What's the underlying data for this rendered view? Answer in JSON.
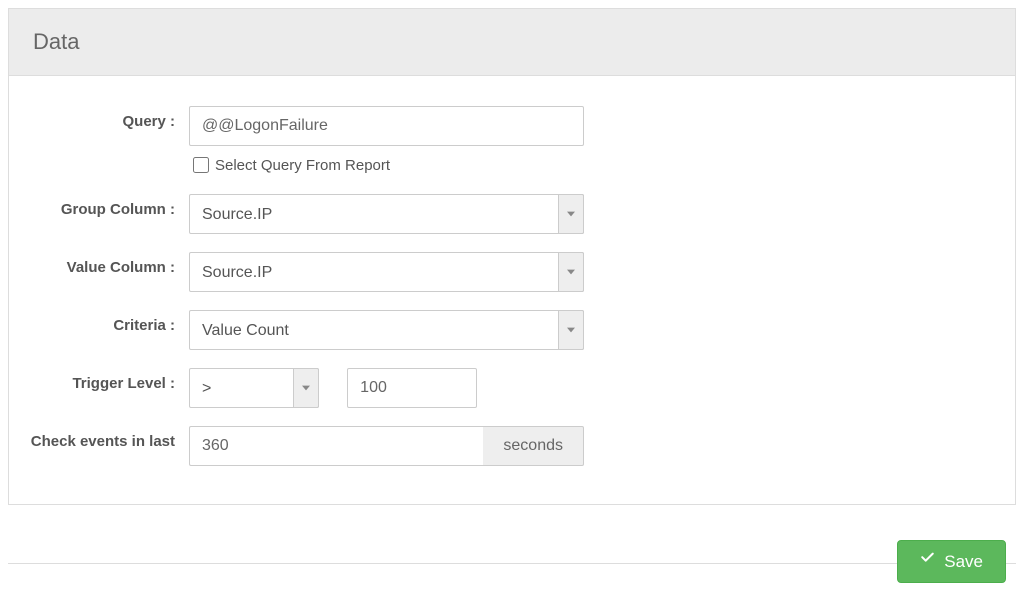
{
  "panel": {
    "title": "Data"
  },
  "form": {
    "query": {
      "label": "Query :",
      "value": "@@LogonFailure",
      "select_from_report_label": "Select Query From Report",
      "select_from_report_checked": false
    },
    "group_column": {
      "label": "Group Column :",
      "value": "Source.IP"
    },
    "value_column": {
      "label": "Value Column :",
      "value": "Source.IP"
    },
    "criteria": {
      "label": "Criteria :",
      "value": "Value Count"
    },
    "trigger": {
      "label": "Trigger Level :",
      "operator": ">",
      "value": "100"
    },
    "check_events": {
      "label": "Check events in last",
      "value": "360",
      "unit": "seconds"
    }
  },
  "actions": {
    "save_label": "Save"
  }
}
